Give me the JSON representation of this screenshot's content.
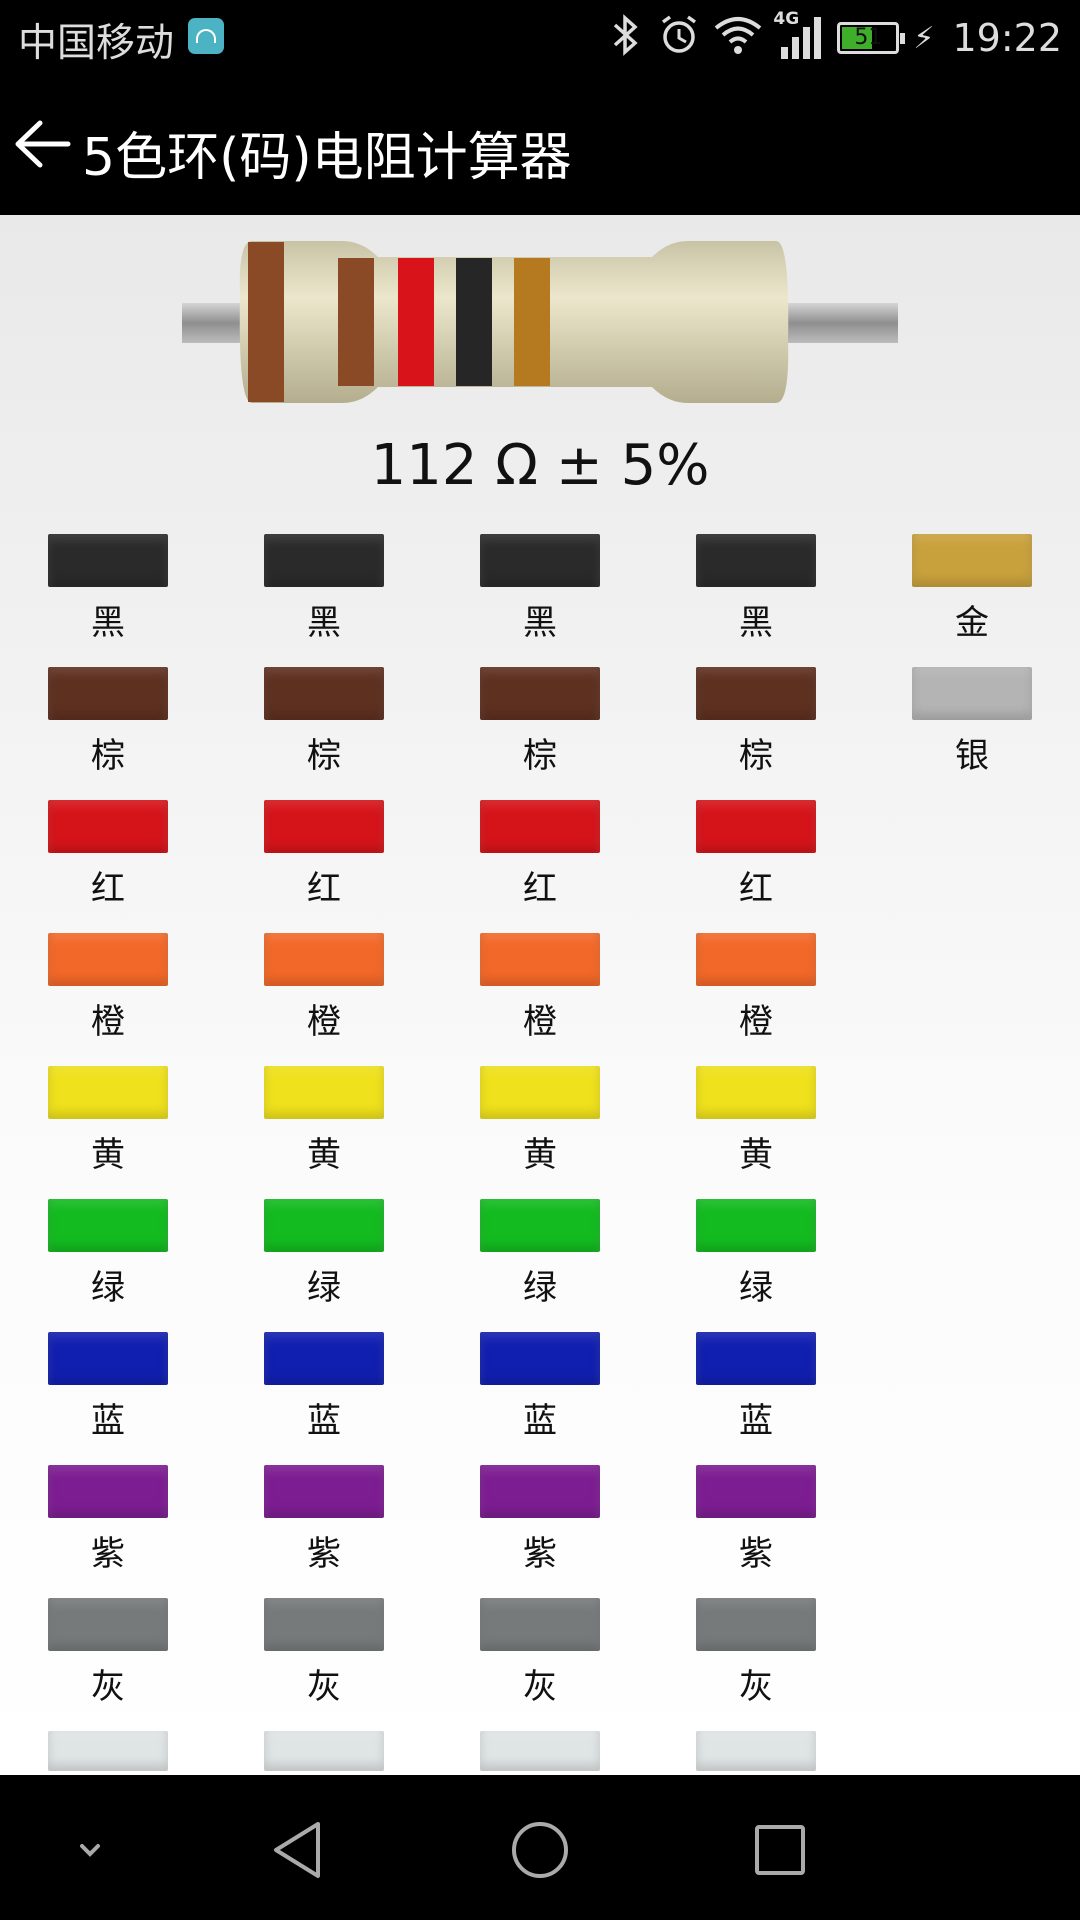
{
  "status_bar": {
    "carrier": "中国移动",
    "network": "4G",
    "battery_level": "51",
    "time": "19:22"
  },
  "action_bar": {
    "title": "5色环(码)电阻计算器"
  },
  "resistor": {
    "bands": [
      "#8a4a25",
      "#8a4a25",
      "#d8141a",
      "#262626",
      "#b5791f"
    ],
    "result": "112 Ω ± 5%"
  },
  "palette": {
    "digit_columns": 4,
    "rows": [
      {
        "label": "黑",
        "color": "#2a2a2a"
      },
      {
        "label": "棕",
        "color": "#5e3020"
      },
      {
        "label": "红",
        "color": "#d5141a"
      },
      {
        "label": "橙",
        "color": "#f26828"
      },
      {
        "label": "黄",
        "color": "#efe11b"
      },
      {
        "label": "绿",
        "color": "#13bb20"
      },
      {
        "label": "蓝",
        "color": "#111fb0"
      },
      {
        "label": "紫",
        "color": "#7d1d92"
      },
      {
        "label": "灰",
        "color": "#767a7a"
      },
      {
        "label": "",
        "color": "#dfe4e4"
      }
    ],
    "tolerance_column": [
      {
        "label": "金",
        "color": "#c9a13c"
      },
      {
        "label": "银",
        "color": "#b4b4b4"
      }
    ]
  },
  "nav_bar": {
    "buttons": [
      "hide-keyboard",
      "back",
      "home",
      "recents"
    ]
  }
}
